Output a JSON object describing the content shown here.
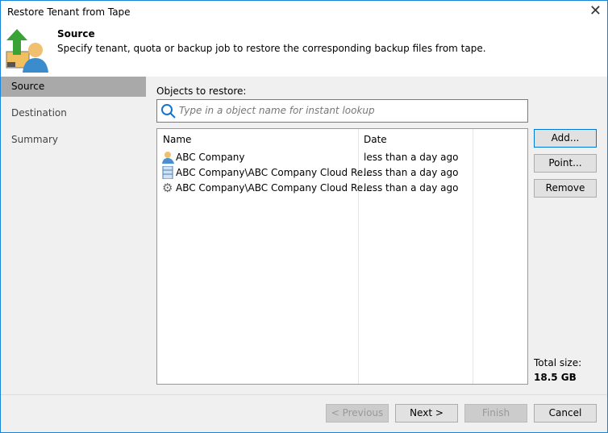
{
  "window": {
    "title": "Restore Tenant from Tape"
  },
  "header": {
    "title": "Source",
    "description": "Specify tenant, quota or backup job to restore the corresponding backup files from tape."
  },
  "sidebar": {
    "items": [
      {
        "label": "Source"
      },
      {
        "label": "Destination"
      },
      {
        "label": "Summary"
      }
    ]
  },
  "main": {
    "objects_label": "Objects to restore:",
    "search_placeholder": "Type in a object name for instant lookup",
    "columns": [
      "Name",
      "Date"
    ],
    "rows": [
      {
        "name": "ABC Company",
        "date": "less than a day ago",
        "icon": "tenant-icon"
      },
      {
        "name": "ABC Company\\ABC Company Cloud Re...",
        "date": "less than a day ago",
        "icon": "repository-icon"
      },
      {
        "name": "ABC Company\\ABC Company Cloud Re...",
        "date": "less than a day ago",
        "icon": "gear-icon"
      }
    ],
    "add": "Add...",
    "point": "Point...",
    "remove": "Remove",
    "total_label": "Total size:",
    "total_value": "18.5 GB"
  },
  "footer": {
    "previous": "< Previous",
    "next": "Next >",
    "finish": "Finish",
    "cancel": "Cancel"
  }
}
